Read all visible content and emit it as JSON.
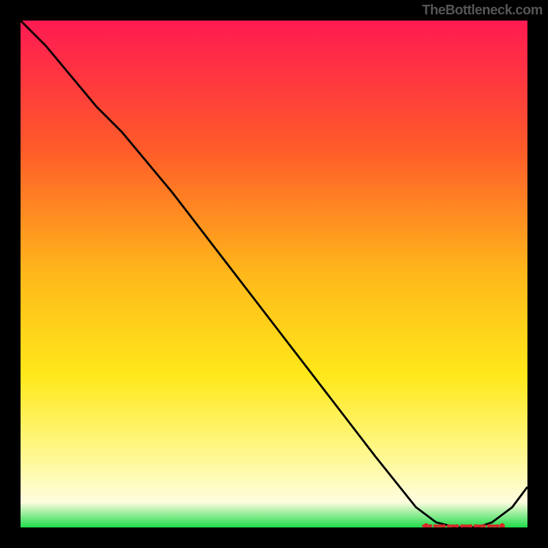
{
  "watermark": "TheBottleneck.com",
  "chart_data": {
    "type": "line",
    "title": "",
    "xlabel": "",
    "ylabel": "",
    "xlim": [
      0,
      1
    ],
    "ylim": [
      0,
      1
    ],
    "series": [
      {
        "name": "curve",
        "x": [
          0.0,
          0.05,
          0.1,
          0.15,
          0.2,
          0.25,
          0.3,
          0.4,
          0.5,
          0.6,
          0.7,
          0.78,
          0.82,
          0.86,
          0.9,
          0.93,
          0.97,
          1.0
        ],
        "values": [
          1.0,
          0.95,
          0.89,
          0.83,
          0.78,
          0.72,
          0.66,
          0.53,
          0.4,
          0.27,
          0.14,
          0.04,
          0.01,
          0.0,
          0.0,
          0.01,
          0.04,
          0.08
        ]
      }
    ],
    "optimal_region": {
      "x_start": 0.8,
      "x_end": 0.95
    },
    "background_gradient": [
      {
        "stop": 0.0,
        "color": "#ff1a52"
      },
      {
        "stop": 0.25,
        "color": "#ff5a2a"
      },
      {
        "stop": 0.5,
        "color": "#ffb81a"
      },
      {
        "stop": 0.7,
        "color": "#ffe81a"
      },
      {
        "stop": 0.85,
        "color": "#fff88a"
      },
      {
        "stop": 0.95,
        "color": "#fffde0"
      },
      {
        "stop": 1.0,
        "color": "#1fdc4a"
      }
    ]
  }
}
